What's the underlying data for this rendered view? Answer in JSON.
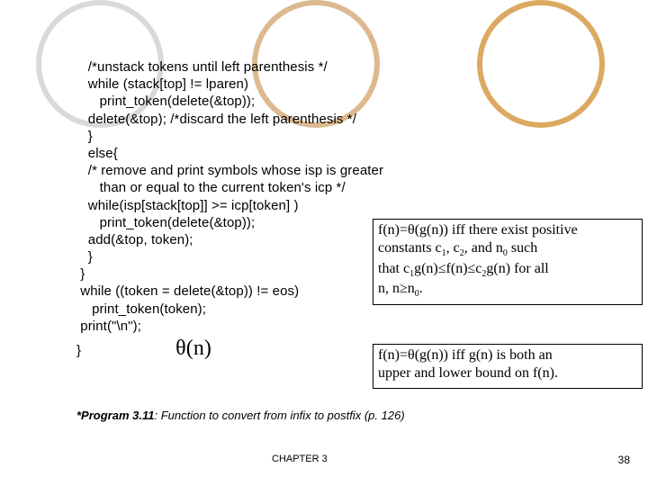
{
  "code": {
    "l1": "   /*unstack tokens until left parenthesis */",
    "l2": "   while (stack[top] != lparen)",
    "l3": "      print_token(delete(&top));",
    "l4": "   delete(&top); /*discard the left parenthesis */",
    "l5": "   }",
    "l6": "   else{",
    "l7": "   /* remove and print symbols whose isp is greater",
    "l8": "      than or equal to the current token's icp */",
    "l9": "   while(isp[stack[top]] >= icp[token] )",
    "l10": "      print_token(delete(&top));",
    "l11": "   add(&top, token);",
    "l12": "   }",
    "l13": " }",
    "l14": " while ((token = delete(&top)) != eos)",
    "l15": "    print_token(token);",
    "l16": " print(\"\\n\");",
    "l17": "}",
    "theta_inline": "θ(n)"
  },
  "caption": {
    "bold": "*Program 3.11",
    "rest": ": Function to convert from infix to postfix (p. 126)"
  },
  "box1": {
    "t1a": "f(n)=",
    "theta": "θ",
    "t1b": "(g(n)) iff there exist positive",
    "t2a": "constants c",
    "t2b": ", c",
    "t2c": ", and n",
    "t2d": " such",
    "t3a": "that c",
    "t3b": "g(n)",
    "le1": "≤",
    "t3c": "f(n)",
    "le2": "≤",
    "t3d": "c",
    "t3e": "g(n) for all",
    "t4a": "n, n",
    "ge": "≥",
    "t4b": "n",
    "t4c": "."
  },
  "box2": {
    "t1a": "f(n)=",
    "theta": "θ",
    "t1b": "(g(n)) iff g(n) is both an",
    "t2": "upper and lower bound on f(n)."
  },
  "footer": {
    "chapter": "CHAPTER 3",
    "page": "38"
  }
}
